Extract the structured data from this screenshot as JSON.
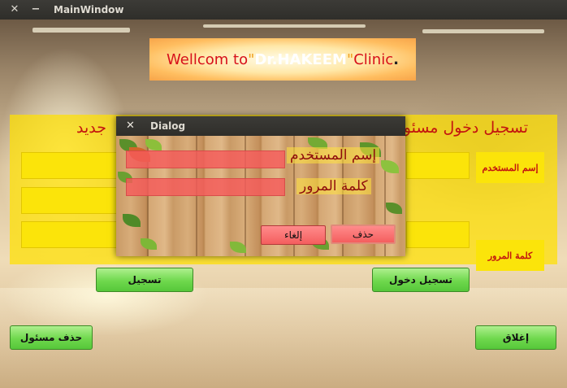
{
  "window": {
    "title": "MainWindow",
    "close_glyph": "✕",
    "minimize_glyph": "−"
  },
  "welcome": {
    "part1": "Wellcom to",
    "quote": "\"",
    "name": "Dr.HAKEEM",
    "part2": "Clinic",
    "period": "."
  },
  "panel": {
    "heading_right": "تسجيل دخول مسئول",
    "heading_left": "جديد",
    "username_label": "إسم المستخدم",
    "password_label": "كلمة المرور"
  },
  "buttons": {
    "register": "تسجيل",
    "login": "تسجيل دخول",
    "delete_admin": "حذف مسئول",
    "close": "إغلاق"
  },
  "dialog": {
    "title": "Dialog",
    "close_glyph": "✕",
    "username_label": "إسم المستخدم",
    "password_label": "كلمة المرور",
    "delete_button": "حذف",
    "cancel_button": "إلغاء"
  },
  "colors": {
    "accent_red": "#c3140f",
    "panel_yellow": "#ffe100",
    "button_green": "#6fd84d",
    "dialog_button_red": "#f45e5e"
  }
}
